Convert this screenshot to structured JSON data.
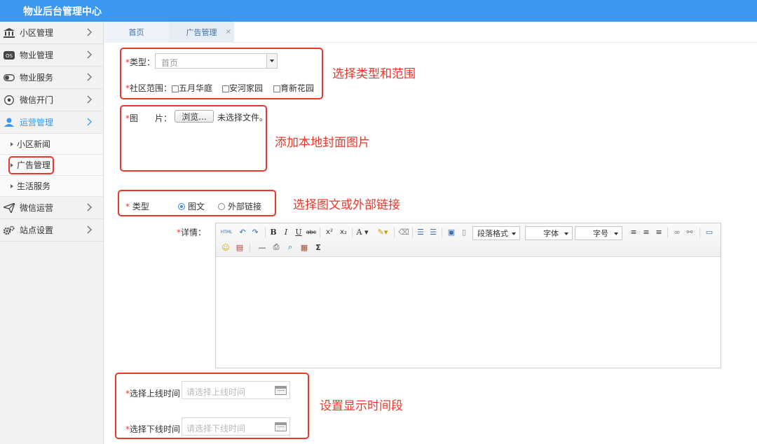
{
  "app": {
    "title": "物业后台管理中心"
  },
  "sidebar": {
    "items": [
      {
        "label": "小区管理",
        "icon": "bank-icon"
      },
      {
        "label": "物业管理",
        "icon": "os-badge-icon"
      },
      {
        "label": "物业服务",
        "icon": "toggle-icon"
      },
      {
        "label": "微信开门",
        "icon": "soccer-ball-icon"
      },
      {
        "label": "运营管理",
        "icon": "user-icon",
        "active": true
      },
      {
        "label": "微信运营",
        "icon": "send-icon"
      },
      {
        "label": "站点设置",
        "icon": "gears-icon"
      }
    ],
    "subitems": [
      {
        "label": "小区新闻"
      },
      {
        "label": "广告管理",
        "selected": true
      },
      {
        "label": "生活服务"
      }
    ]
  },
  "tabs": [
    {
      "label": "首页"
    },
    {
      "label": "广告管理",
      "close": "×"
    }
  ],
  "form": {
    "required_mark": "*",
    "type_label": "类型：",
    "type_value": "首页",
    "scope_label": "社区范围：",
    "communities": [
      "五月华庭",
      "安河家园",
      "育新花园"
    ],
    "image_label": "图　　片：",
    "browse_button": "浏览...",
    "no_file_text": "未选择文件。",
    "content_type_label": " 类型",
    "content_types": [
      {
        "label": "图文",
        "checked": true
      },
      {
        "label": "外部链接",
        "checked": false
      }
    ],
    "detail_label": "详情：",
    "online_label": "选择上线时间",
    "online_placeholder": "请选择上线时间",
    "offline_label": "选择下线时间",
    "offline_placeholder": "请选择下线时间"
  },
  "editor": {
    "html_label": "HTML",
    "paragraph_label": "段落格式",
    "font_label": "字体",
    "size_label": "字号",
    "sigma_label": "Σ"
  },
  "annotations": {
    "type_scope": "选择类型和范围",
    "cover_image": "添加本地封面图片",
    "link_type": "选择图文或外部链接",
    "time_range": "设置显示时间段"
  },
  "colors": {
    "topbar": "#3a98f0",
    "accent": "#3a98f0",
    "annotation": "#e8382b"
  }
}
